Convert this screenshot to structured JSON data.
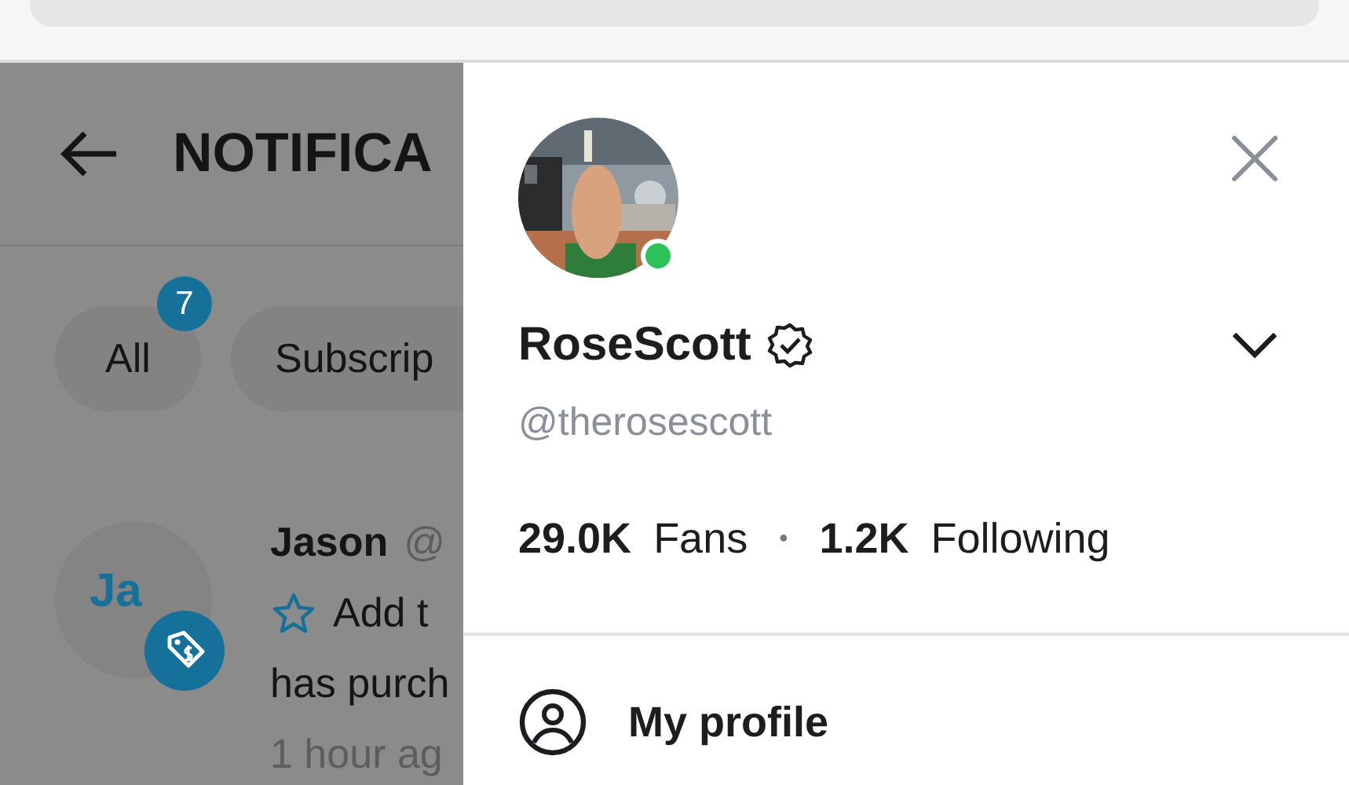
{
  "notifications_page": {
    "title": "NOTIFICA",
    "filters": [
      {
        "label": "All",
        "badge": "7"
      },
      {
        "label": "Subscrip"
      }
    ],
    "notification": {
      "avatar_initials": "Ja",
      "name": "Jason",
      "handle": "@",
      "message_start": "Add t",
      "message_line2": "has purch",
      "time": "1 hour ag"
    }
  },
  "profile_panel": {
    "name": "RoseScott",
    "verified": true,
    "online": true,
    "handle": "@therosescott",
    "fans_count": "29.0K",
    "fans_label": "Fans",
    "separator": "•",
    "following_count": "1.2K",
    "following_label": "Following",
    "menu": [
      {
        "label": "My profile"
      }
    ]
  }
}
